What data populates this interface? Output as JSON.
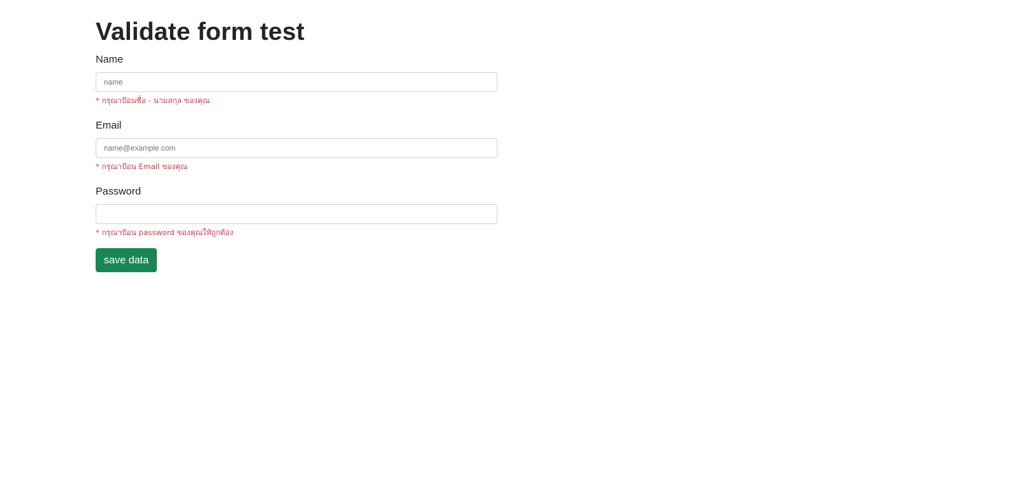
{
  "page": {
    "title": "Validate form test"
  },
  "form": {
    "name": {
      "label": "Name",
      "placeholder": "name",
      "value": "",
      "error": "* กรุณาป้อนชื่อ - นามสกุล ของคุณ"
    },
    "email": {
      "label": "Email",
      "placeholder": "name@example.com",
      "value": "",
      "error": "* กรุณาป้อน Email ของคุณ"
    },
    "password": {
      "label": "Password",
      "placeholder": "",
      "value": "",
      "error": "* กรุณาป้อน password ของคุณให้ถูกต้อง"
    },
    "save_label": "save data"
  },
  "colors": {
    "error": "#dc3545",
    "button": "#198754",
    "input_border": "#ced4da",
    "text": "#212529"
  }
}
